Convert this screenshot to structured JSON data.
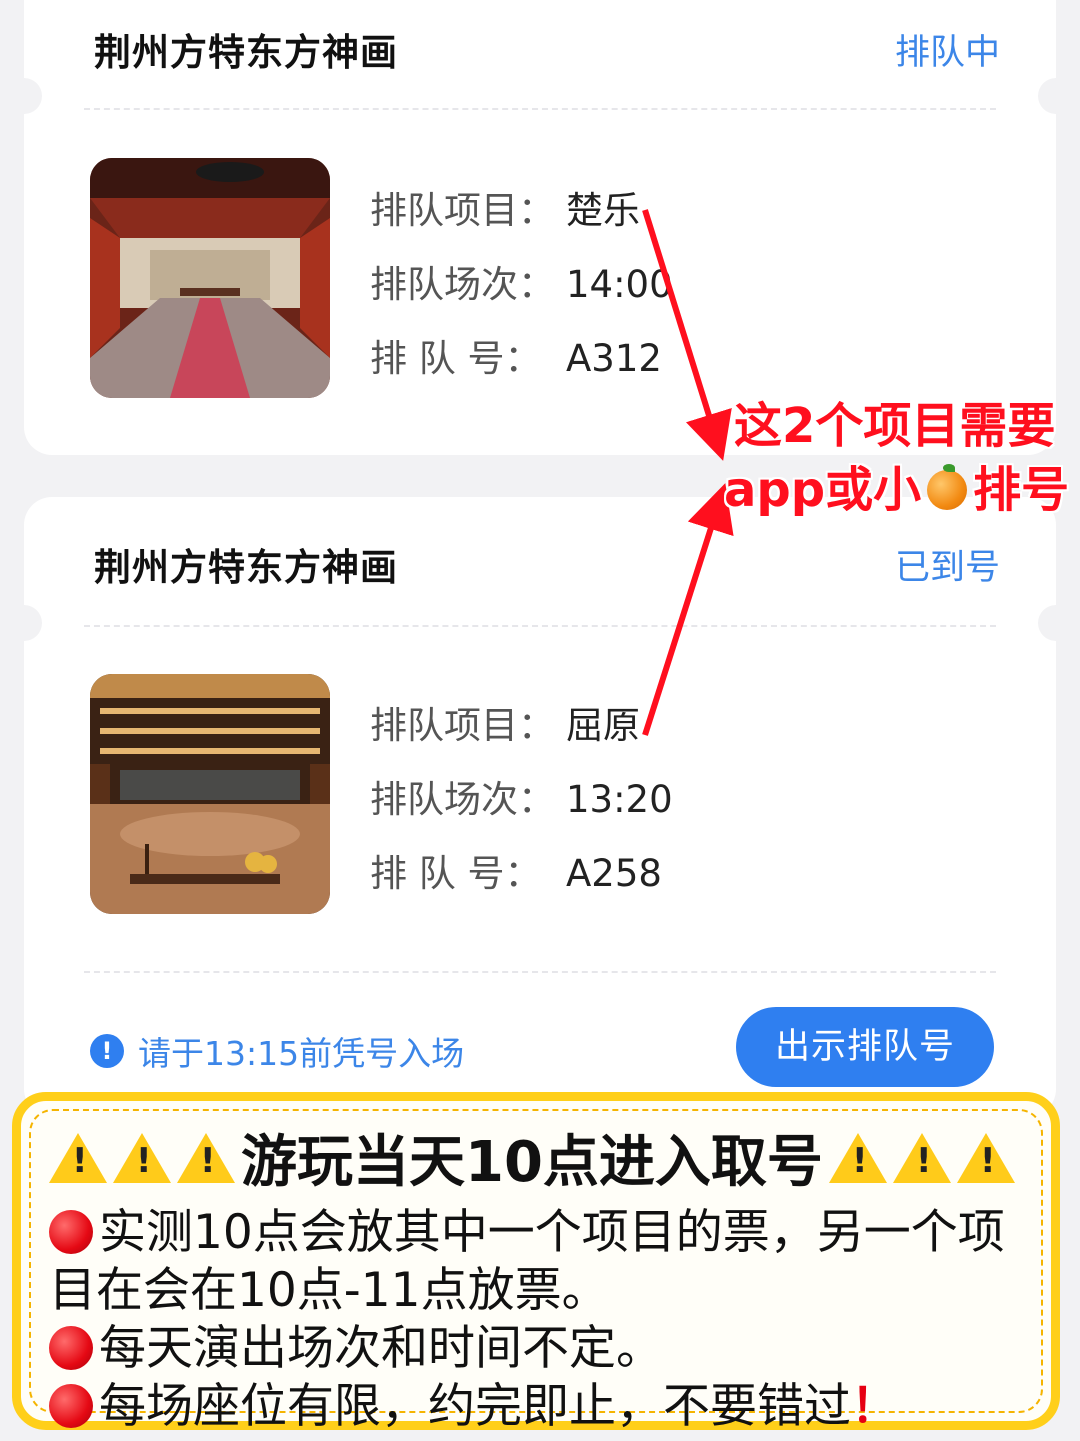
{
  "cards": [
    {
      "title": "荆州方特东方神画",
      "status": "排队中",
      "rows": [
        {
          "label": "排队项目：",
          "value": "楚乐"
        },
        {
          "label": "排队场次：",
          "value": "14:00"
        },
        {
          "label": "排  队  号：",
          "value": "A312"
        }
      ]
    },
    {
      "title": "荆州方特东方神画",
      "status": "已到号",
      "rows": [
        {
          "label": "排队项目：",
          "value": "屈原"
        },
        {
          "label": "排队场次：",
          "value": "13:20"
        },
        {
          "label": "排  队  号：",
          "value": "A258"
        }
      ],
      "hint": "请于13:15前凭号入场",
      "button": "出示排队号"
    }
  ],
  "annotation": {
    "line1": "这2个项目需要",
    "line2a": "app或小",
    "line2b": "排号"
  },
  "notice": {
    "title": "游玩当天10点进入取号",
    "lines": [
      "实测10点会放其中一个项目的票，另一个项",
      "目在会在10点-11点放票。",
      "每天演出场次和时间不定。",
      "每场座位有限，约完即止，不要错过"
    ],
    "exclaim": "！"
  },
  "colors": {
    "accent": "#2f7ff0",
    "status_text": "#3c86e8",
    "annotation_red": "#ff0f1e",
    "notice_border": "#ffcf1a"
  }
}
